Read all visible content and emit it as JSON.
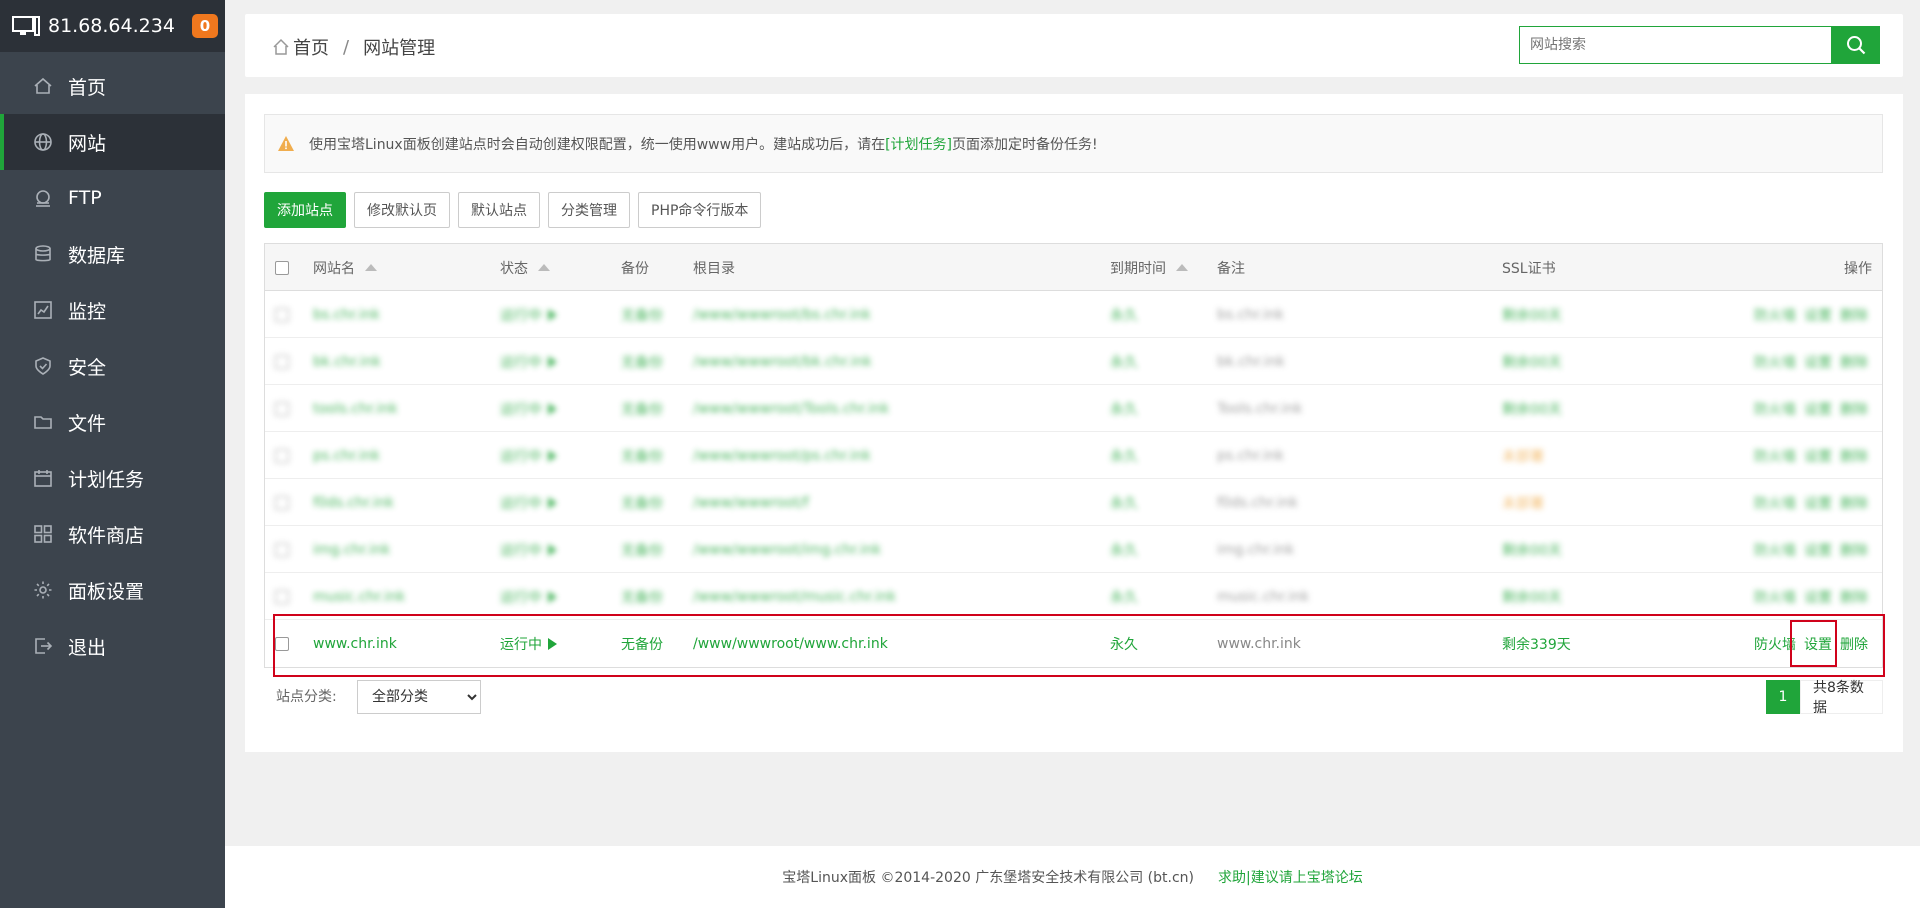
{
  "server": {
    "ip": "81.68.64.234",
    "badge": "0"
  },
  "nav": [
    {
      "label": "首页",
      "icon": "home-icon"
    },
    {
      "label": "网站",
      "icon": "globe-icon",
      "active": true
    },
    {
      "label": "FTP",
      "icon": "ftp-icon"
    },
    {
      "label": "数据库",
      "icon": "database-icon"
    },
    {
      "label": "监控",
      "icon": "monitor-chart-icon"
    },
    {
      "label": "安全",
      "icon": "shield-icon"
    },
    {
      "label": "文件",
      "icon": "folder-icon"
    },
    {
      "label": "计划任务",
      "icon": "calendar-icon"
    },
    {
      "label": "软件商店",
      "icon": "apps-grid-icon"
    },
    {
      "label": "面板设置",
      "icon": "gear-icon"
    },
    {
      "label": "退出",
      "icon": "logout-icon"
    }
  ],
  "breadcrumb": {
    "home": "首页",
    "sep": "/",
    "current": "网站管理"
  },
  "search": {
    "placeholder": "网站搜索"
  },
  "alert": {
    "text_before": "使用宝塔Linux面板创建站点时会自动创建权限配置，统一使用www用户。建站成功后，请在",
    "link": "[计划任务]",
    "text_after": "页面添加定时备份任务!"
  },
  "toolbar": {
    "add_site": "添加站点",
    "modify_default": "修改默认页",
    "default_site": "默认站点",
    "category_manage": "分类管理",
    "php_cli": "PHP命令行版本"
  },
  "table": {
    "headers": {
      "name": "网站名",
      "status": "状态",
      "backup": "备份",
      "root": "根目录",
      "expire": "到期时间",
      "note": "备注",
      "ssl": "SSL证书",
      "ops": "操作"
    },
    "rows": [
      {
        "name": "bs.chr.ink",
        "status": "运行中",
        "backup": "无备份",
        "root": "/www/wwwroot/bs.chr.ink",
        "expire": "永久",
        "note": "bs.chr.ink",
        "ssl": "剩余00天",
        "ssl_color": "green",
        "blurred": true
      },
      {
        "name": "bk.chr.ink",
        "status": "运行中",
        "backup": "无备份",
        "root": "/www/wwwroot/bk.chr.ink",
        "expire": "永久",
        "note": "bk.chr.ink",
        "ssl": "剩余00天",
        "ssl_color": "green",
        "blurred": true
      },
      {
        "name": "tools.chr.ink",
        "status": "运行中",
        "backup": "无备份",
        "root": "/www/wwwroot/Tools.chr.ink",
        "expire": "永久",
        "note": "Tools.chr.ink",
        "ssl": "剩余00天",
        "ssl_color": "green",
        "blurred": true
      },
      {
        "name": "ps.chr.ink",
        "status": "运行中",
        "backup": "无备份",
        "root": "/www/wwwroot/ps.chr.ink",
        "expire": "永久",
        "note": "ps.chr.ink",
        "ssl": "未部署",
        "ssl_color": "orange",
        "blurred": true
      },
      {
        "name": "f0ds.chr.ink",
        "status": "运行中",
        "backup": "无备份",
        "root": "/www/wwwroot/f",
        "expire": "永久",
        "note": "f0ds.chr.ink",
        "ssl": "未部署",
        "ssl_color": "orange",
        "blurred": true
      },
      {
        "name": "img.chr.ink",
        "status": "运行中",
        "backup": "无备份",
        "root": "/www/wwwroot/img.chr.ink",
        "expire": "永久",
        "note": "img.chr.ink",
        "ssl": "剩余00天",
        "ssl_color": "green",
        "blurred": true
      },
      {
        "name": "music.chr.ink",
        "status": "运行中",
        "backup": "无备份",
        "root": "/www/wwwroot/music.chr.ink",
        "expire": "永久",
        "note": "music.chr.ink",
        "ssl": "剩余00天",
        "ssl_color": "green",
        "blurred": true
      },
      {
        "name": "www.chr.ink",
        "status": "运行中",
        "backup": "无备份",
        "root": "/www/wwwroot/www.chr.ink",
        "expire": "永久",
        "note": "www.chr.ink",
        "ssl": "剩余339天",
        "ssl_color": "green",
        "blurred": false
      }
    ],
    "ops": {
      "firewall": "防火墙",
      "settings": "设置",
      "delete": "删除"
    }
  },
  "footer_controls": {
    "category_label": "站点分类:",
    "category_selected": "全部分类",
    "page": "1",
    "total": "共8条数据"
  },
  "copyright": {
    "text": "宝塔Linux面板 ©2014-2020 广东堡塔安全技术有限公司 (bt.cn)",
    "help": "求助|建议请上宝塔论坛"
  },
  "colors": {
    "accent": "#20a53a",
    "sidebar": "#3c444d",
    "highlight": "#d0021b",
    "warning": "#f0ad4e"
  }
}
